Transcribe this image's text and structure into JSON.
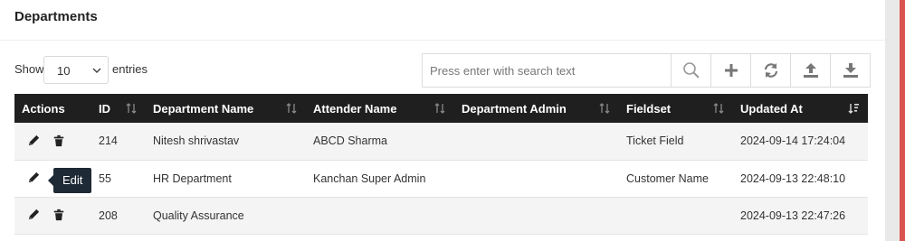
{
  "page": {
    "title": "Departments"
  },
  "controls": {
    "show_label": "Show",
    "entries_value": "10",
    "entries_label": "entries",
    "search_placeholder": "Press enter with search text"
  },
  "toolbar": {
    "icons": [
      "search-icon",
      "plus-icon",
      "refresh-icon",
      "upload-icon",
      "download-icon"
    ]
  },
  "table": {
    "columns": [
      "Actions",
      "ID",
      "Department Name",
      "Attender Name",
      "Department Admin",
      "Fieldset",
      "Updated At"
    ],
    "rows": [
      {
        "id": "214",
        "department_name": "Nitesh shrivastav",
        "attender_name": "ABCD Sharma",
        "department_admin": "",
        "fieldset": "Ticket Field",
        "updated_at": "2024-09-14 17:24:04"
      },
      {
        "id": "55",
        "department_name": "HR Department",
        "attender_name": "Kanchan Super Admin",
        "department_admin": "",
        "fieldset": "Customer Name",
        "updated_at": "2024-09-13 22:48:10"
      },
      {
        "id": "208",
        "department_name": "Quality Assurance",
        "attender_name": "",
        "department_admin": "",
        "fieldset": "",
        "updated_at": "2024-09-13 22:47:26"
      }
    ]
  },
  "tooltip": {
    "text": "Edit"
  },
  "colors": {
    "header_bg": "#1f1f1f",
    "accent_red": "#d9534f",
    "tooltip_bg": "#1e2a35"
  }
}
